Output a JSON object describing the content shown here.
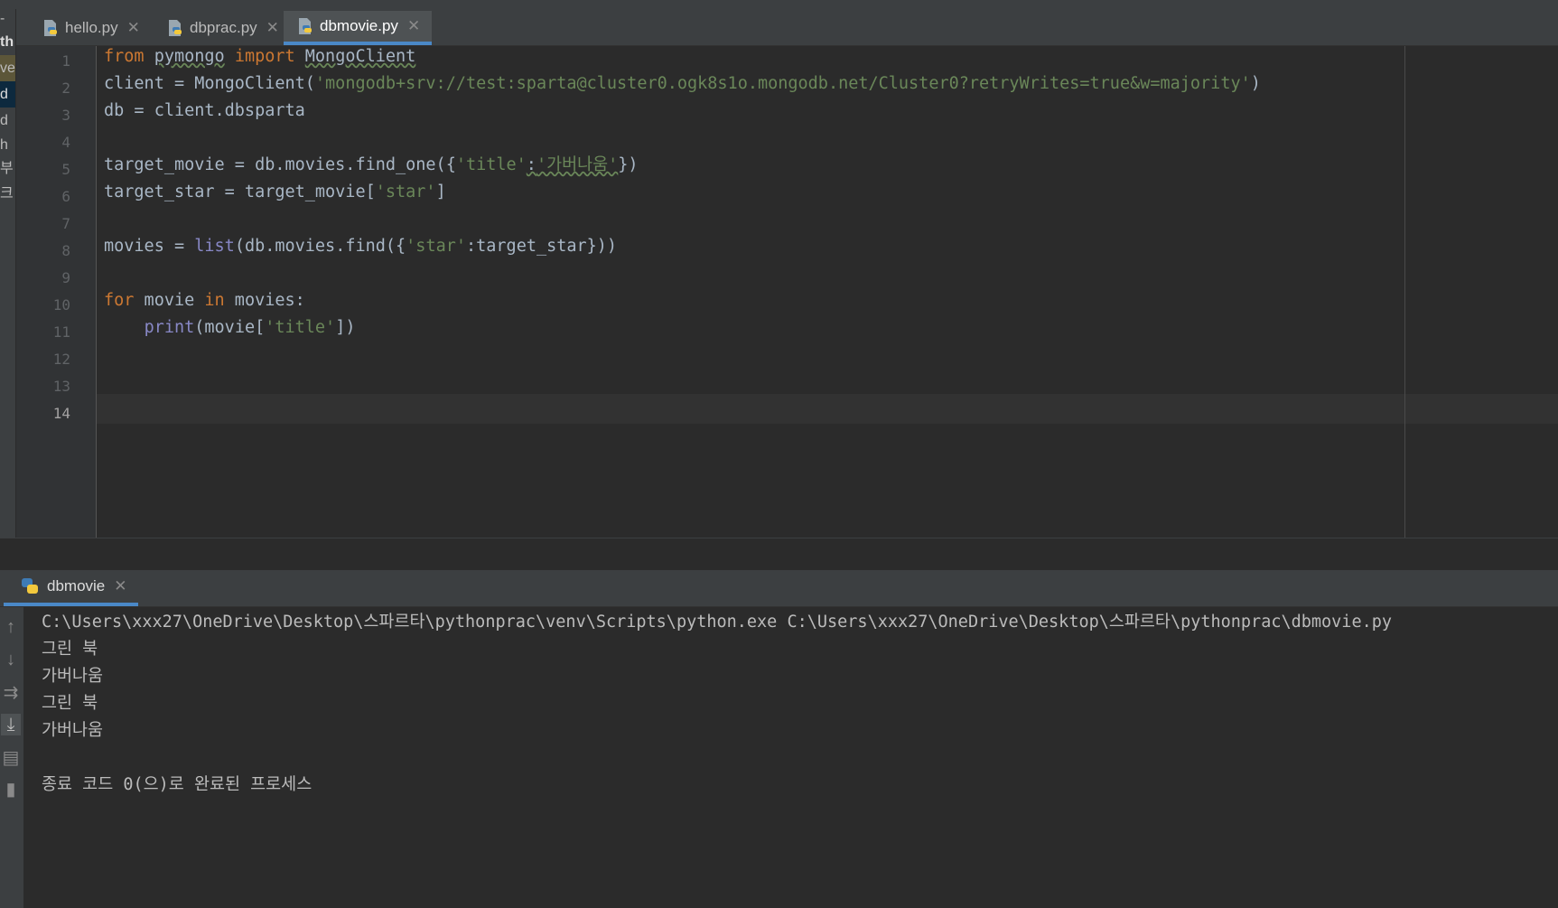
{
  "tabs": [
    {
      "label": "hello.py",
      "active": false
    },
    {
      "label": "dbprac.py",
      "active": false
    },
    {
      "label": "dbmovie.py",
      "active": true
    }
  ],
  "project_strip": [
    "-",
    "th",
    "ve",
    "d",
    "d",
    "h",
    "부",
    "크"
  ],
  "editor": {
    "line_numbers": [
      "1",
      "2",
      "3",
      "4",
      "5",
      "6",
      "7",
      "8",
      "9",
      "10",
      "11",
      "12",
      "13",
      "14"
    ],
    "current_line": "14",
    "lines": [
      [
        "from",
        " ",
        "pymongo",
        " ",
        "import",
        " ",
        "MongoClient"
      ],
      [
        "client = MongoClient(",
        "'mongodb+srv://test:sparta@cluster0.ogk8s1o.mongodb.net/Cluster0?retryWrites=true&w=majority'",
        ")"
      ],
      [
        "db = client.dbsparta"
      ],
      [],
      [
        "target_movie = db.movies.find_one({",
        "'title'",
        ":",
        "'가버나움'",
        "})"
      ],
      [
        "target_star = target_movie[",
        "'star'",
        "]"
      ],
      [],
      [
        "movies = ",
        "list",
        "(db.movies.find({",
        "'star'",
        ":target_star}))"
      ],
      [],
      [
        "for",
        " movie ",
        "in",
        " movies:"
      ],
      [
        "    ",
        "print",
        "(movie[",
        "'title'",
        "])"
      ],
      [],
      [],
      []
    ]
  },
  "run": {
    "tab_label": "dbmovie",
    "output": [
      "C:\\Users\\xxx27\\OneDrive\\Desktop\\스파르타\\pythonprac\\venv\\Scripts\\python.exe C:\\Users\\xxx27\\OneDrive\\Desktop\\스파르타\\pythonprac\\dbmovie.py",
      "그린 북",
      "가버나움",
      "그린 북",
      "가버나움",
      "",
      "종료 코드 0(으)로 완료된 프로세스"
    ]
  },
  "toolbar_icons": [
    "up-arrow-icon",
    "down-arrow-icon",
    "soft-wrap-icon",
    "scroll-to-end-icon",
    "print-icon",
    "trash-icon"
  ],
  "colors": {
    "keyword": "#cc7832",
    "string": "#6a8759",
    "builtin": "#8888c6",
    "default": "#a9b7c6",
    "accent": "#4a88c7"
  }
}
